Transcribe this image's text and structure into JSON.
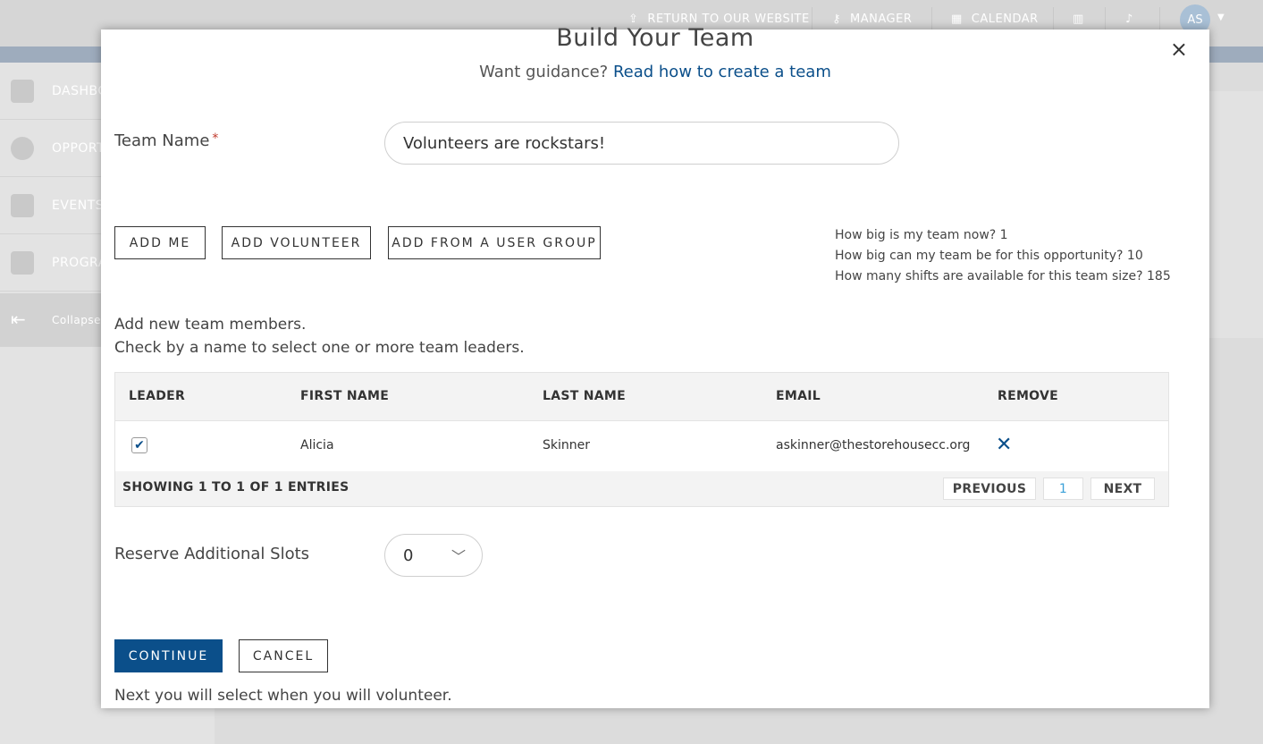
{
  "topbar": {
    "return_label": "RETURN TO OUR WEBSITE",
    "manager_label": "MANAGER",
    "calendar_label": "CALENDAR",
    "avatar_initials": "AS"
  },
  "sidebar": {
    "items": [
      {
        "label": "DASHBO"
      },
      {
        "label": "OPPORT"
      },
      {
        "label": "EVENTS"
      },
      {
        "label": "PROGRA"
      },
      {
        "label": "Collapse"
      }
    ]
  },
  "modal": {
    "title": "Build Your Team",
    "guidance_prefix": "Want guidance?",
    "guidance_link": "Read how to create a team",
    "close_symbol": "×",
    "team_name_label": "Team Name",
    "required_mark": "*",
    "team_name_value": "Volunteers are rockstars!",
    "buttons": {
      "add_me": "ADD ME",
      "add_volunteer": "ADD VOLUNTEER",
      "add_from_group": "ADD FROM A USER GROUP",
      "continue": "CONTINUE",
      "cancel": "CANCEL"
    },
    "info": {
      "current_size": "How big is my team now? 1",
      "max_size": "How big can my team be for this opportunity? 10",
      "shifts_available": "How many shifts are available for this team size? 185"
    },
    "instructions": {
      "line1": "Add new team members.",
      "line2": "Check by a name to select one or more team leaders."
    },
    "table": {
      "headers": {
        "leader": "LEADER",
        "first_name": "FIRST NAME",
        "last_name": "LAST NAME",
        "email": "EMAIL",
        "remove": "REMOVE"
      },
      "rows": [
        {
          "leader_checked": "✔",
          "first_name": "Alicia",
          "last_name": "Skinner",
          "email": "askinner@thestorehousecc.org",
          "remove_symbol": "✕"
        }
      ],
      "footer_text": "SHOWING 1 TO 1 OF 1 ENTRIES",
      "pagination": {
        "previous": "PREVIOUS",
        "current_page": "1",
        "next": "NEXT"
      }
    },
    "reserve_label": "Reserve Additional Slots",
    "reserve_value": "0",
    "next_text": "Next you will select when you will volunteer."
  }
}
